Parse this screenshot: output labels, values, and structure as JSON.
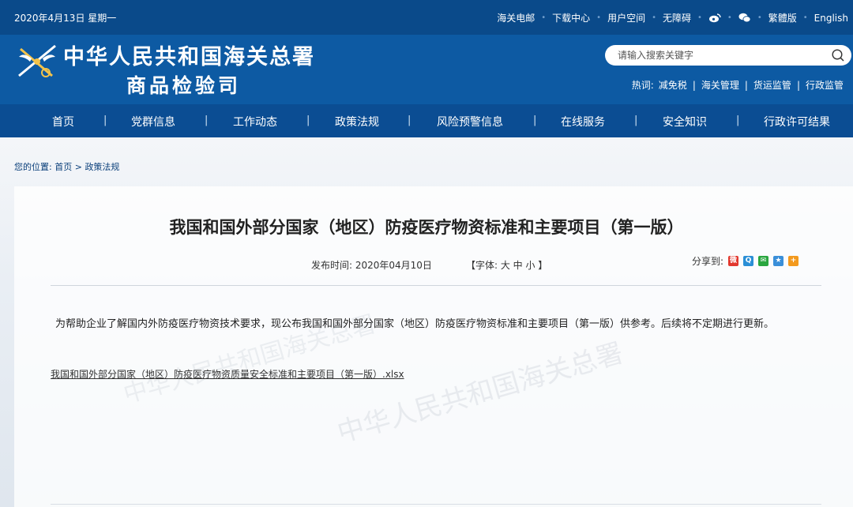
{
  "topbar": {
    "date": "2020年4月13日 星期一",
    "links": [
      "海关电邮",
      "下载中心",
      "用户空间",
      "无障碍"
    ],
    "lang_links": [
      "繁體版",
      "English"
    ],
    "icons": [
      "weibo-icon",
      "wechat-icon"
    ]
  },
  "brand": {
    "title_line1": "中华人民共和国海关总署",
    "title_line2": "商品检验司"
  },
  "search": {
    "placeholder": "请输入搜索关键字"
  },
  "hot": {
    "label": "热词:",
    "items": [
      "减免税",
      "海关管理",
      "货运监管",
      "行政监管"
    ]
  },
  "nav": {
    "items": [
      "首页",
      "党群信息",
      "工作动态",
      "政策法规",
      "风险预警信息",
      "在线服务",
      "安全知识",
      "行政许可结果"
    ]
  },
  "breadcrumb": {
    "label": "您的位置:",
    "home": "首页",
    "sep": ">",
    "current": "政策法规"
  },
  "article": {
    "title": "我国和国外部分国家（地区）防疫医疗物资标准和主要项目（第一版）",
    "publish": "发布时间: 2020年04月10日",
    "font_label": "【字体: 大 中 小 】",
    "share_label": "分享到:",
    "share_icons": [
      "weibo-share-icon",
      "qzone-share-icon",
      "wechat-share-icon",
      "qq-share-icon",
      "more-share-icon"
    ],
    "paragraph": "为帮助企业了解国内外防疫医疗物资技术要求，现公布我国和国外部分国家（地区）防疫医疗物资标准和主要项目（第一版）供参考。后续将不定期进行更新。",
    "attachment": "我国和国外部分国家（地区）防疫医疗物资质量安全标准和主要项目（第一版）.xlsx"
  },
  "watermark": "中华人民共和国海关总署",
  "colors": {
    "topbar": "#0a4a8a",
    "brand": "#0d5aa3",
    "nav": "#0b4d93",
    "link": "#0a3f7a"
  }
}
